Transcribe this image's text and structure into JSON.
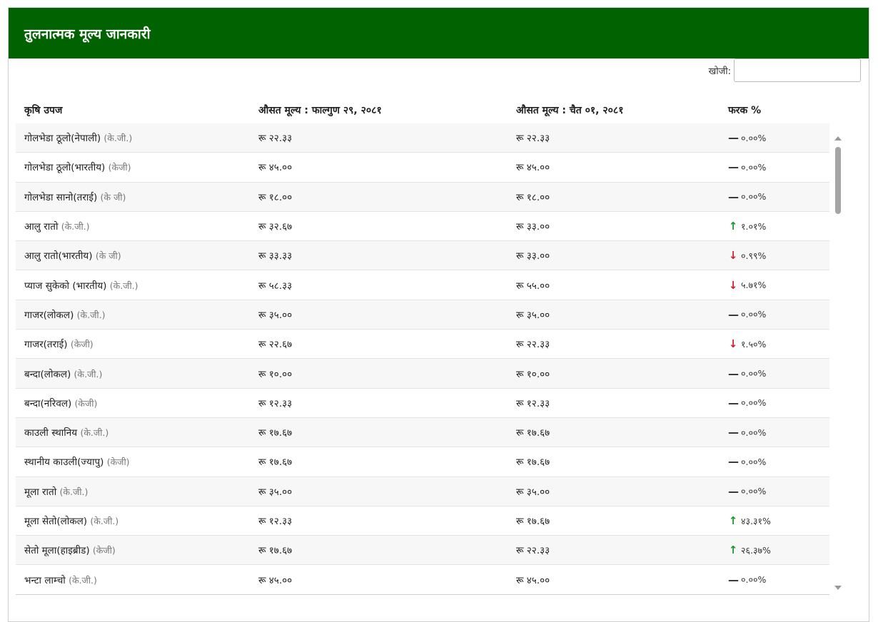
{
  "header": {
    "title": "तुलनात्मक मूल्य जानकारी"
  },
  "search": {
    "label": "खोजी:",
    "placeholder": "",
    "value": ""
  },
  "table": {
    "columns": [
      "कृषि उपज",
      "औसत मूल्य : फाल्गुण २९, २०८१",
      "औसत मूल्य : चैत ०१, २०८१",
      "फरक %"
    ],
    "rows": [
      {
        "name": "गोलभेडा ठूलो(नेपाली)",
        "unit": "(के.जी.)",
        "price1": "रू २२.३३",
        "price2": "रू २२.३३",
        "trend": "same",
        "diff": "०.००%"
      },
      {
        "name": "गोलभेडा ठूलो(भारतीय)",
        "unit": "(केजी)",
        "price1": "रू ४५.००",
        "price2": "रू ४५.००",
        "trend": "same",
        "diff": "०.००%"
      },
      {
        "name": "गोलभेडा सानो(तराई)",
        "unit": "(के जी)",
        "price1": "रू १८.००",
        "price2": "रू १८.००",
        "trend": "same",
        "diff": "०.००%"
      },
      {
        "name": "आलु रातो",
        "unit": "(के.जी.)",
        "price1": "रू ३२.६७",
        "price2": "रू ३३.००",
        "trend": "up",
        "diff": "१.०१%"
      },
      {
        "name": "आलु रातो(भारतीय)",
        "unit": "(के जी)",
        "price1": "रू ३३.३३",
        "price2": "रू ३३.००",
        "trend": "down",
        "diff": "०.९९%"
      },
      {
        "name": "प्याज सुकेको (भारतीय)",
        "unit": "(के.जी.)",
        "price1": "रू ५८.३३",
        "price2": "रू ५५.००",
        "trend": "down",
        "diff": "५.७१%"
      },
      {
        "name": "गाजर(लोकल)",
        "unit": "(के.जी.)",
        "price1": "रू ३५.००",
        "price2": "रू ३५.००",
        "trend": "same",
        "diff": "०.००%"
      },
      {
        "name": "गाजर(तराई)",
        "unit": "(केजी)",
        "price1": "रू २२.६७",
        "price2": "रू २२.३३",
        "trend": "down",
        "diff": "१.५०%"
      },
      {
        "name": "बन्दा(लोकल)",
        "unit": "(के.जी.)",
        "price1": "रू १०.००",
        "price2": "रू १०.००",
        "trend": "same",
        "diff": "०.००%"
      },
      {
        "name": "बन्दा(नरिवल)",
        "unit": "(केजी)",
        "price1": "रू १२.३३",
        "price2": "रू १२.३३",
        "trend": "same",
        "diff": "०.००%"
      },
      {
        "name": "काउली स्थानिय",
        "unit": "(के.जी.)",
        "price1": "रू १७.६७",
        "price2": "रू १७.६७",
        "trend": "same",
        "diff": "०.००%"
      },
      {
        "name": "स्थानीय काउली(ज्यापु)",
        "unit": "(केजी)",
        "price1": "रू १७.६७",
        "price2": "रू १७.६७",
        "trend": "same",
        "diff": "०.००%"
      },
      {
        "name": "मूला रातो",
        "unit": "(के.जी.)",
        "price1": "रू ३५.००",
        "price2": "रू ३५.००",
        "trend": "same",
        "diff": "०.००%"
      },
      {
        "name": "मूला सेतो(लोकल)",
        "unit": "(के.जी.)",
        "price1": "रू १२.३३",
        "price2": "रू १७.६७",
        "trend": "up",
        "diff": "४३.३१%"
      },
      {
        "name": "सेतो मूला(हाइब्रीड)",
        "unit": "(केजी)",
        "price1": "रू १७.६७",
        "price2": "रू २२.३३",
        "trend": "up",
        "diff": "२६.३७%"
      },
      {
        "name": "भन्टा लाम्चो",
        "unit": "(के.जी.)",
        "price1": "रू ४५.००",
        "price2": "रू ४५.००",
        "trend": "same",
        "diff": "०.००%"
      }
    ]
  },
  "icons": {
    "up": "arrow-up-icon",
    "down": "arrow-down-icon",
    "same": "dash-icon"
  },
  "colors": {
    "header_bg": "#006200",
    "up": "#1a9a2a",
    "down": "#d4202a"
  }
}
